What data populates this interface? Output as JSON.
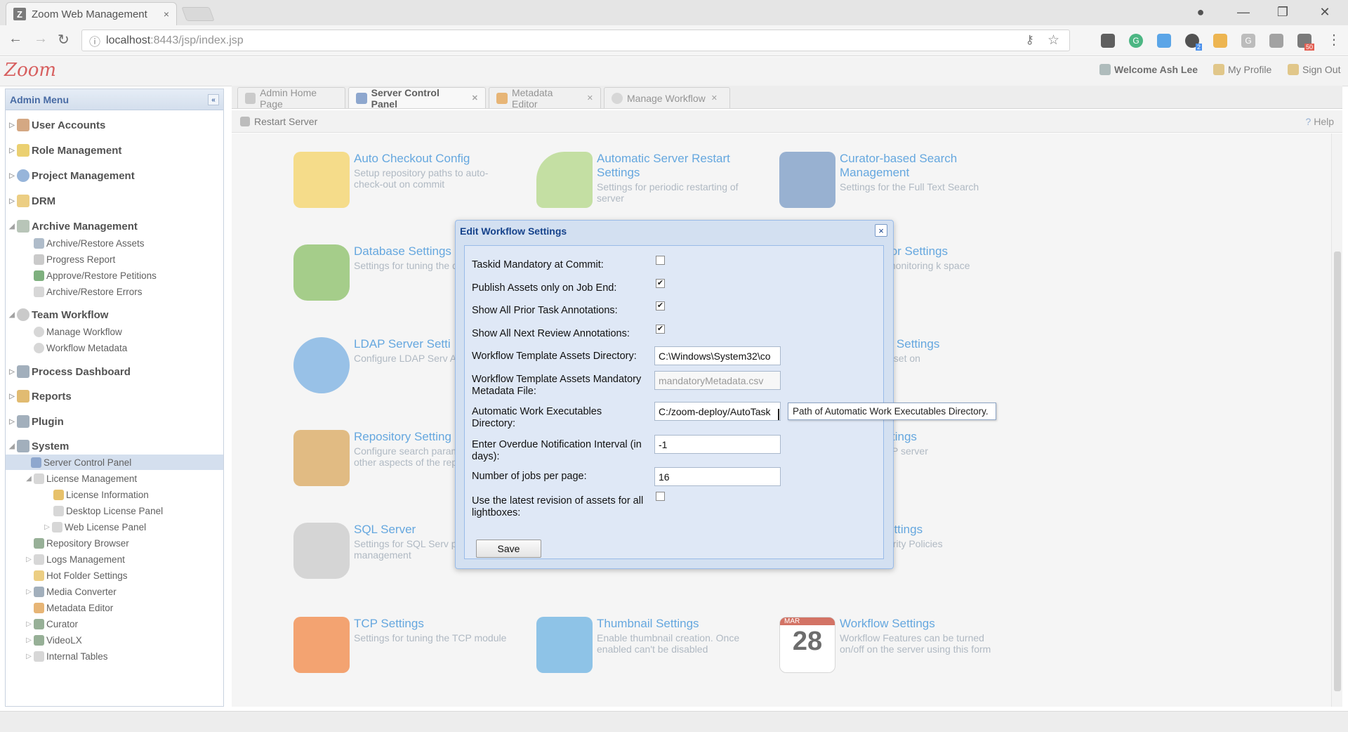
{
  "browser": {
    "tab_title": "Zoom Web Management",
    "tab_close": "×",
    "address_host": "localhost",
    "address_path": ":8443/jsp/index.jsp",
    "ext_badge_1": "2",
    "ext_badge_2": "50"
  },
  "header": {
    "logo": "Zoom",
    "welcome": "Welcome Ash Lee",
    "my_profile": "My Profile",
    "sign_out": "Sign Out"
  },
  "sidebar": {
    "title": "Admin Menu",
    "items": [
      {
        "label": "User Accounts"
      },
      {
        "label": "Role Management"
      },
      {
        "label": "Project Management"
      },
      {
        "label": "DRM"
      },
      {
        "label": "Archive Management"
      },
      {
        "label": "Archive/Restore Assets"
      },
      {
        "label": "Progress Report"
      },
      {
        "label": "Approve/Restore Petitions"
      },
      {
        "label": "Archive/Restore Errors"
      },
      {
        "label": "Team Workflow"
      },
      {
        "label": "Manage Workflow"
      },
      {
        "label": "Workflow Metadata"
      },
      {
        "label": "Process Dashboard"
      },
      {
        "label": "Reports"
      },
      {
        "label": "Plugin"
      },
      {
        "label": "System"
      },
      {
        "label": "Server Control Panel"
      },
      {
        "label": "License Management"
      },
      {
        "label": "License Information"
      },
      {
        "label": "Desktop License Panel"
      },
      {
        "label": "Web License Panel"
      },
      {
        "label": "Repository Browser"
      },
      {
        "label": "Logs Management"
      },
      {
        "label": "Hot Folder Settings"
      },
      {
        "label": "Media Converter"
      },
      {
        "label": "Metadata Editor"
      },
      {
        "label": "Curator"
      },
      {
        "label": "VideoLX"
      },
      {
        "label": "Internal Tables"
      }
    ]
  },
  "tabs": [
    {
      "label": "Admin Home Page"
    },
    {
      "label": "Server Control Panel"
    },
    {
      "label": "Metadata Editor"
    },
    {
      "label": "Manage Workflow"
    }
  ],
  "subbar": {
    "restart": "Restart Server",
    "help": "Help"
  },
  "cards": [
    {
      "title": "Auto Checkout Config",
      "desc": "Setup repository paths to auto-check-out on commit"
    },
    {
      "title": "Automatic Server Restart Settings",
      "desc": "Settings for periodic restarting of server"
    },
    {
      "title": "Curator-based Search Management",
      "desc": "Settings for the Full Text Search"
    },
    {
      "title": "Database Settings",
      "desc": "Settings for tuning the database"
    },
    {
      "title": "tor Settings",
      "desc": "monitoring k space"
    },
    {
      "title": "LDAP Server Setti",
      "desc": "Configure LDAP Serv Access"
    },
    {
      "title": "et Settings",
      "desc": "asset on"
    },
    {
      "title": "Repository Setting",
      "desc": "Configure search parameters and other aspects of the reposit"
    },
    {
      "title": "tings",
      "desc": "P server"
    },
    {
      "title": "SQL Server",
      "desc": "Settings for SQL Serv process management"
    },
    {
      "title": "ettings",
      "desc": "urity Policies"
    },
    {
      "title": "TCP Settings",
      "desc": "Settings for tuning the TCP module"
    },
    {
      "title": "Thumbnail Settings",
      "desc": "Enable thumbnail creation. Once enabled can't be disabled"
    },
    {
      "title": "Workflow Settings",
      "desc": "Workflow Features can be turned on/off on the server using this form"
    }
  ],
  "calendar": {
    "month": "MAR",
    "day": "28"
  },
  "modal": {
    "title": "Edit Workflow Settings",
    "close": "×",
    "fields": {
      "taskid_label": "Taskid Mandatory at Commit:",
      "publish_label": "Publish Assets only on Job End:",
      "prior_label": "Show All Prior Task Annotations:",
      "next_label": "Show All Next Review Annotations:",
      "template_dir_label": "Workflow Template Assets Directory:",
      "template_dir_value": "C:\\Windows\\System32\\co",
      "metadata_file_label": "Workflow Template Assets Mandatory Metadata File:",
      "metadata_file_value": "mandatoryMetadata.csv",
      "auto_exec_label": "Automatic Work Executables Directory:",
      "auto_exec_value": "C:/zoom-deploy/AutoTask",
      "overdue_label": "Enter Overdue Notification Interval (in days):",
      "overdue_value": "-1",
      "jobs_label": "Number of jobs per page:",
      "jobs_value": "16",
      "latest_label": "Use the latest revision of assets for all lightboxes:"
    },
    "checks": {
      "taskid": false,
      "publish": true,
      "prior": true,
      "next": true,
      "latest": false
    },
    "save": "Save"
  },
  "tooltip": "Path of Automatic Work Executables Directory."
}
